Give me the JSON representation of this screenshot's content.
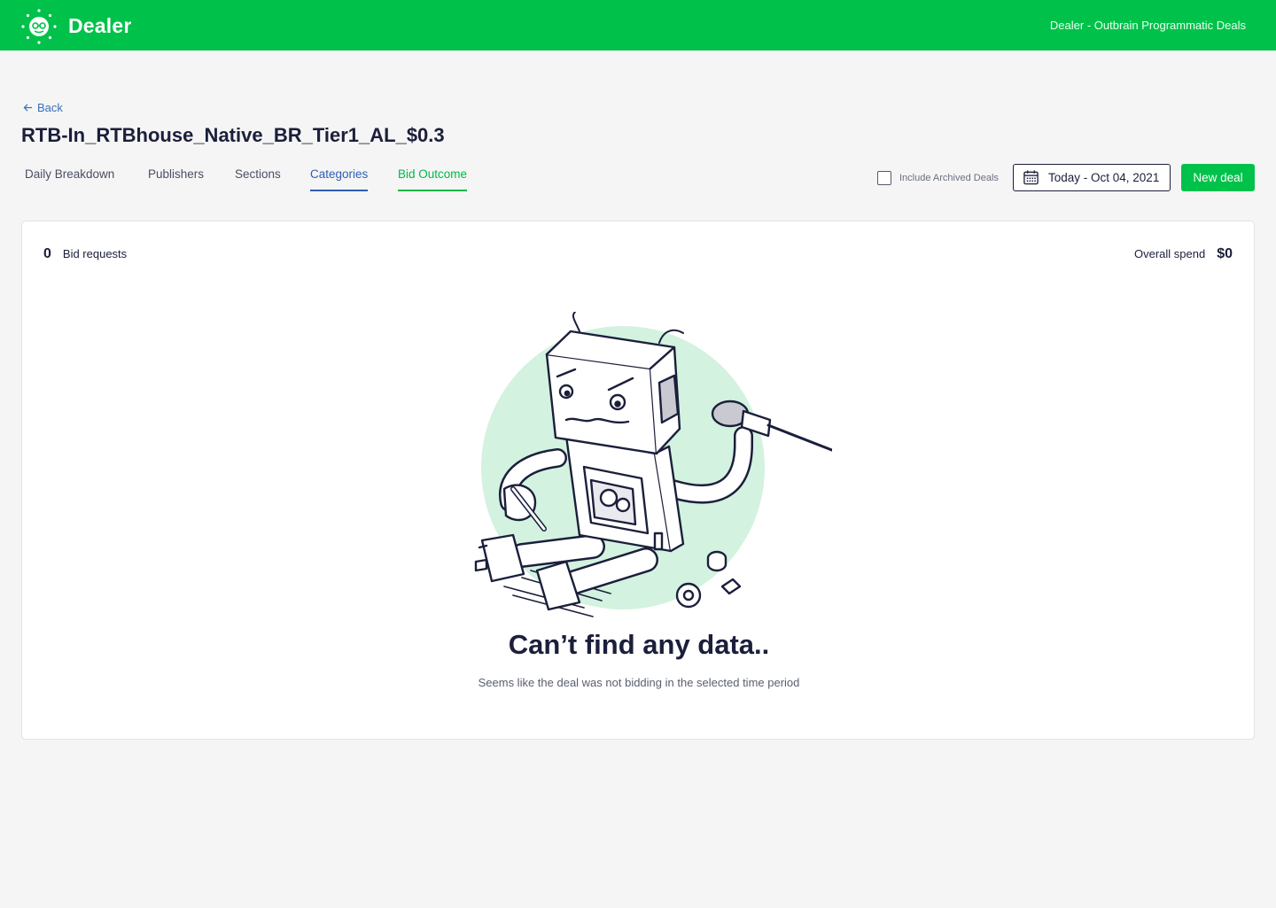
{
  "topbar": {
    "brand": "Dealer",
    "title": "Dealer - Outbrain Programmatic Deals",
    "brand_color": "#00c24a"
  },
  "nav": {
    "back_label": "Back"
  },
  "deal": {
    "name": "RTB-In_RTBhouse_Native_BR_Tier1_AL_$0.3"
  },
  "tabs": [
    {
      "label": "Daily Breakdown",
      "active": false
    },
    {
      "label": "Publishers",
      "active": false
    },
    {
      "label": "Sections",
      "active": false
    },
    {
      "label": "Categories",
      "active": true
    },
    {
      "label": "Bid Outcome",
      "active": true
    }
  ],
  "filters": {
    "archived_label": "Include Archived Deals",
    "archived_checked": false,
    "date_range": "Today - Oct 04, 2021",
    "new_deal_label": "New deal"
  },
  "stats": {
    "bid_requests_value": "0",
    "bid_requests_label": "Bid requests",
    "overall_spend_label": "Overall spend",
    "overall_spend_value": "$0"
  },
  "empty_state": {
    "title": "Can’t find any data..",
    "subtitle": "Seems like the deal was not bidding in the selected time period",
    "illustration": "broken-robot"
  }
}
